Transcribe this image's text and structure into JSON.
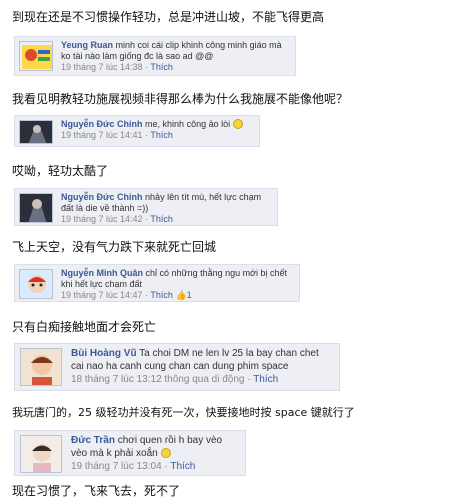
{
  "lines": [
    "到现在还是不习惯操作轻功，总是冲进山坡，不能飞得更高",
    "我看见明教轻功施展视频非得那么棒为什么我施展不能像他呢？",
    "哎呦，轻功太酷了",
    "飞上天空，没有气力跌下来就死亡回城",
    "只有白痴接触地面才会死亡",
    "我玩唐门的，25 级轻功并没有死一次，快要接地时按 space 键就行了",
    "现在习惯了，飞来飞去，死不了"
  ],
  "comments": [
    {
      "name": "Yeung Ruan",
      "message": "minh coi cái clip khinh công minh giáo mà ko tài nào làm giống đc là sao ad @@",
      "time": "19 tháng 7 lúc 14:38",
      "dot": " · ",
      "like": "Thích"
    },
    {
      "name": "Nguyễn Đức Chinh",
      "message": "me, khinh công ảo lòi",
      "time": "19 tháng 7 lúc 14:41",
      "dot": " · ",
      "like": "Thích"
    },
    {
      "name": "Nguyễn Đức Chinh",
      "message": "nhảy lên tít mù, hết lực chạm đất là die về thành =))",
      "time": "19 tháng 7 lúc 14:42",
      "dot": " · ",
      "like": "Thích"
    },
    {
      "name": "Nguyễn Minh Quân",
      "message": "chỉ có những thằng ngu mới bị chết khi hết lực chạm đất",
      "time": "19 tháng 7 lúc 14:47",
      "dot": " · ",
      "like": "Thích",
      "likes_count": "1"
    },
    {
      "name": "Bùi Hoàng Vũ",
      "message": "Ta choi DM ne len lv 25 la bay chan chet cai nao ha canh cung chan can dung phim space",
      "time": "18 tháng 7 lúc 13:12 thông qua di động",
      "dot": " · ",
      "like": "Thích"
    },
    {
      "name": "Đức Trần",
      "message": "chơi quen rồi h bay vèo vèo mà k phải xoắn",
      "time": "19 tháng 7 lúc 13:04",
      "dot": " · ",
      "like": "Thích"
    }
  ],
  "colors": {
    "link": "#3b5998",
    "card_bg": "#edeff4",
    "card_border": "#d8dfea",
    "meta": "#888888"
  }
}
